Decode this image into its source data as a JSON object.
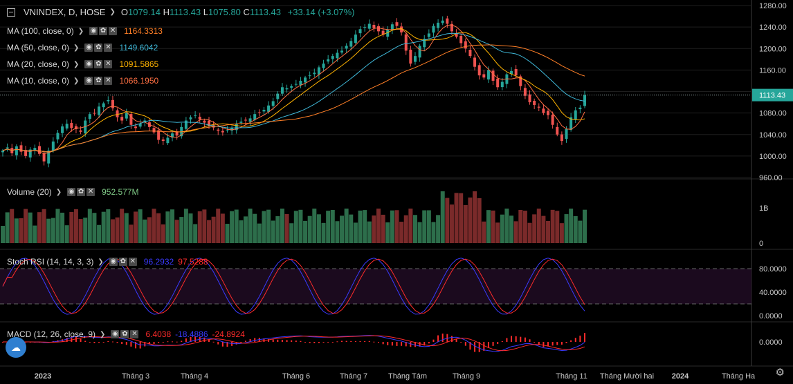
{
  "header": {
    "symbol": "VNINDEX, D, HOSE",
    "open_label": "O",
    "open": "1079.14",
    "high_label": "H",
    "high": "1113.43",
    "low_label": "L",
    "low": "1075.80",
    "close_label": "C",
    "close": "1113.43",
    "change": "+33.14 (+3.07%)"
  },
  "indicators": {
    "ma100": {
      "label": "MA (100, close, 0)",
      "value": "1164.3313",
      "color": "#ff7f27"
    },
    "ma50": {
      "label": "MA (50, close, 0)",
      "value": "1149.6042",
      "color": "#3fb8d8"
    },
    "ma20": {
      "label": "MA (20, close, 0)",
      "value": "1091.5865",
      "color": "#ffb300"
    },
    "ma10": {
      "label": "MA (10, close, 0)",
      "value": "1066.1950",
      "color": "#ff7043"
    },
    "volume": {
      "label": "Volume (20)",
      "value": "952.577M",
      "color": "#7ec885"
    },
    "stoch": {
      "label": "Stoch RSI (14, 14, 3, 3)",
      "k": "96.2932",
      "d": "97.5288",
      "k_color": "#3a3aff",
      "d_color": "#ff2b2b"
    },
    "macd": {
      "label": "MACD (12, 26, close, 9)",
      "hist": "6.4038",
      "macd": "-18.4886",
      "signal": "-24.8924",
      "hist_color": "#ff2b2b",
      "macd_color": "#3a3aff",
      "signal_color": "#ff2b2b"
    }
  },
  "price_axis": {
    "ticks": [
      "1280.00",
      "1240.00",
      "1200.00",
      "1160.00",
      "1120.00",
      "1080.00",
      "1040.00",
      "1000.00",
      "960.00"
    ],
    "last": "1113.43"
  },
  "volume_axis": {
    "ticks": [
      "1B",
      "0"
    ]
  },
  "stoch_axis": {
    "ticks": [
      "80.0000",
      "40.0000",
      "0.0000"
    ]
  },
  "macd_axis": {
    "ticks": [
      "0.0000"
    ]
  },
  "time_axis": {
    "labels": [
      "2023",
      "Tháng 3",
      "Tháng 4",
      "Tháng 6",
      "Tháng 7",
      "Tháng Tám",
      "Tháng 9",
      "Tháng 11",
      "Tháng Mười hai",
      "2024",
      "Tháng Ha"
    ]
  },
  "colors": {
    "up": "#26a69a",
    "down": "#ef5350",
    "vol_up": "#2d6e4b",
    "vol_down": "#7a2a2a",
    "grid": "#1e1e1e"
  },
  "chart_data": {
    "type": "candlestick",
    "series_ohlc_close_trend": [
      1010,
      1016,
      1005,
      1018,
      1008,
      1000,
      1012,
      1015,
      1004,
      990,
      1010,
      1027,
      1043,
      1055,
      1060,
      1052,
      1050,
      1045,
      1066,
      1078,
      1080,
      1092,
      1098,
      1104,
      1089,
      1072,
      1066,
      1080,
      1058,
      1052,
      1060,
      1066,
      1054,
      1044,
      1030,
      1028,
      1034,
      1042,
      1038,
      1054,
      1066,
      1072,
      1076,
      1068,
      1062,
      1056,
      1053,
      1047,
      1044,
      1048,
      1052,
      1060,
      1064,
      1066,
      1070,
      1078,
      1081,
      1086,
      1094,
      1102,
      1116,
      1128,
      1126,
      1130,
      1134,
      1140,
      1146,
      1150,
      1155,
      1165,
      1172,
      1180,
      1186,
      1192,
      1196,
      1205,
      1214,
      1226,
      1236,
      1240,
      1246,
      1238,
      1232,
      1226,
      1235,
      1245,
      1242,
      1230,
      1196,
      1172,
      1186,
      1205,
      1218,
      1228,
      1242,
      1248,
      1252,
      1246,
      1232,
      1222,
      1210,
      1200,
      1186,
      1166,
      1150,
      1146,
      1160,
      1140,
      1128,
      1138,
      1152,
      1158,
      1150,
      1130,
      1112,
      1100,
      1095,
      1090,
      1080,
      1076,
      1058,
      1040,
      1028,
      1050,
      1072,
      1085,
      1090,
      1113.43
    ],
    "ylim": [
      960,
      1280
    ]
  }
}
